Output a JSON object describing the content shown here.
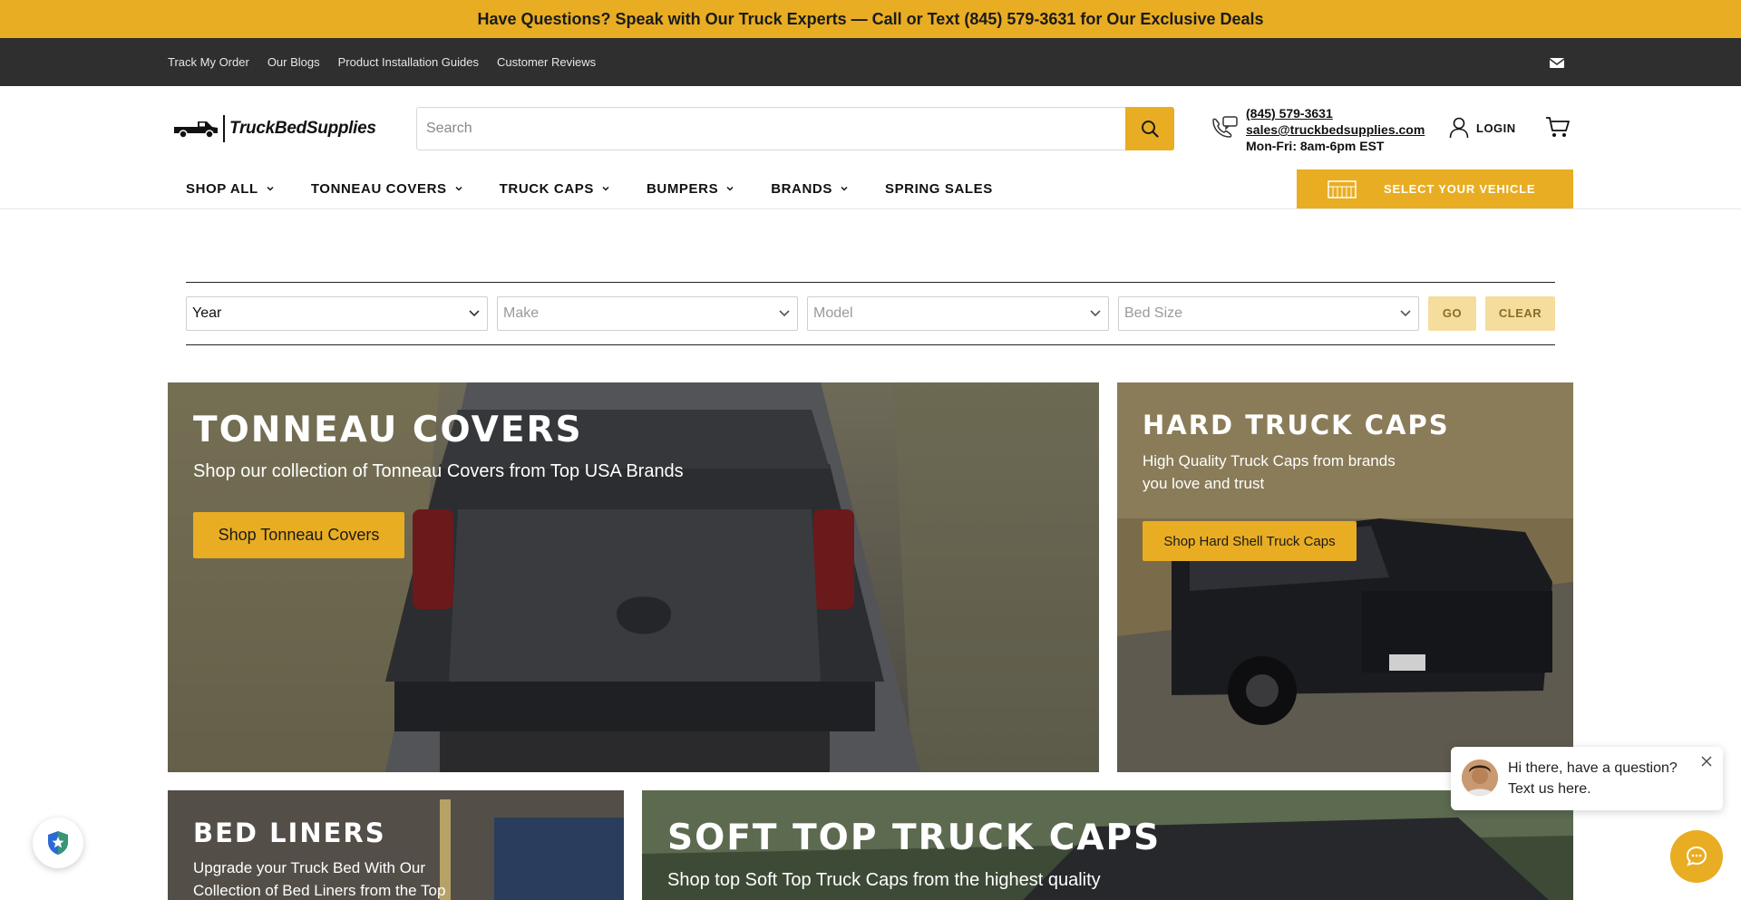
{
  "announcement": "Have Questions? Speak with Our Truck Experts — Call or Text (845) 579-3631 for Our Exclusive Deals",
  "utility_links": [
    "Track My Order",
    "Our Blogs",
    "Product Installation Guides",
    "Customer Reviews"
  ],
  "logo_text": "TruckBedSupplies",
  "search": {
    "placeholder": "Search"
  },
  "contact": {
    "phone": "(845) 579-3631",
    "email": "sales@truckbedsupplies.com",
    "hours": "Mon-Fri: 8am-6pm EST"
  },
  "login_label": "LOGIN",
  "nav": [
    "SHOP ALL",
    "TONNEAU COVERS",
    "TRUCK CAPS",
    "BUMPERS",
    "BRANDS",
    "SPRING SALES"
  ],
  "select_vehicle_label": "SELECT YOUR VEHICLE",
  "filter": {
    "year": "Year",
    "make": "Make",
    "model": "Model",
    "bed_size": "Bed Size",
    "go": "GO",
    "clear": "CLEAR"
  },
  "tiles": {
    "tonneau": {
      "title": "TONNEAU COVERS",
      "subtitle": "Shop our collection of Tonneau Covers from Top USA Brands",
      "cta": "Shop Tonneau Covers"
    },
    "hardcaps": {
      "title": "HARD TRUCK CAPS",
      "subtitle_line1": "High Quality Truck Caps from brands",
      "subtitle_line2": "you love and trust",
      "cta": "Shop Hard Shell Truck Caps"
    },
    "bedliners": {
      "title": "BED LINERS",
      "subtitle_line1": "Upgrade your Truck Bed With Our",
      "subtitle_line2": "Collection of Bed Liners from the Top"
    },
    "softcaps": {
      "title": "SOFT TOP TRUCK CAPS",
      "subtitle": "Shop top Soft Top Truck Caps from the highest quality"
    }
  },
  "chat": {
    "line1": "Hi there, have a question?",
    "line2": "Text us here."
  },
  "colors": {
    "accent": "#e8ad22",
    "dark_bar": "#2f2f2f"
  },
  "icons": [
    "mail-icon",
    "search-icon",
    "phone-chat-icon",
    "user-icon",
    "cart-icon",
    "chevron-down-icon",
    "vehicle-icon",
    "close-icon",
    "chat-bubble-icon",
    "shield-star-icon"
  ]
}
